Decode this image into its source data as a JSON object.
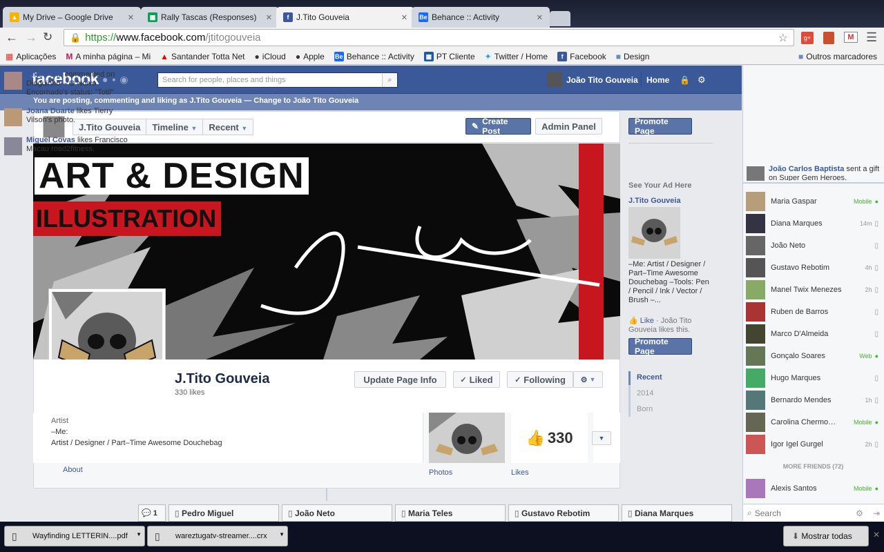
{
  "tabs": [
    {
      "title": "My Drive – Google Drive",
      "icon": "google-drive-icon",
      "color": "#f4b400"
    },
    {
      "title": "Rally Tascas (Responses)",
      "icon": "sheets-icon",
      "color": "#0f9d58"
    },
    {
      "title": "J.Tito Gouveia",
      "icon": "facebook-icon",
      "color": "#3b5998"
    },
    {
      "title": "Behance :: Activity",
      "icon": "behance-icon",
      "color": "#1769ff"
    }
  ],
  "url": {
    "scheme": "https://",
    "host": "www.facebook.com",
    "path": "/jtitogouveia"
  },
  "bookmarks": [
    "Aplicações",
    "A minha página – Mi",
    "Santander Totta Net",
    "iCloud",
    "Apple",
    "Behance :: Activity",
    "PT Cliente",
    "Twitter / Home",
    "Facebook",
    "Design"
  ],
  "bookmarks_other": "Outros marcadores",
  "fb": {
    "logo": "facebook",
    "search_placeholder": "Search for people, places and things",
    "user": "João Tito Gouveia",
    "home": "Home",
    "acting_as": "You are posting, commenting and liking as J.Tito Gouveia — Change to João Tito Gouveia",
    "page_name": "J.Tito Gouveia",
    "timeline": "Timeline",
    "recent": "Recent",
    "create_post": "Create Post",
    "admin_panel": "Admin Panel",
    "cover_title": "ART & DESIGN",
    "cover_sub": "ILLUSTRATION",
    "profile_name": "J.Tito Gouveia",
    "likes_count": "330 likes",
    "update_info": "Update Page Info",
    "liked": "Liked",
    "following": "Following",
    "about_cat": "Artist",
    "about_me": "–Me:",
    "about_desc": "Artist / Designer / Part–Time Awesome Douchebag",
    "about_link": "About",
    "photos_link": "Photos",
    "likes_link": "Likes",
    "likes_big": "330",
    "promote": "Promote Page",
    "ad_heading": "See Your Ad Here",
    "ad_title": "J.Tito Gouveia",
    "ad_text": "–Me: Artist / Designer / Part–Time Awesome Douchebag –Tools: Pen / Pencil / Ink / Vector / Brush –...",
    "ad_like": "Like",
    "ad_like_rest": " · João Tito Gouveia likes this.",
    "years": [
      "Recent",
      "2014",
      "Born"
    ]
  },
  "ticker": [
    {
      "name": "Nika Pena",
      "rest": " commented on Dioguinho – O Noivo Encornado's status: \"Totil\""
    },
    {
      "name": "Joana Duarte",
      "rest": " likes Tierry Vilson's photo."
    },
    {
      "name": "Miguel Covas",
      "rest": " likes Francisco Macau road2fitness."
    },
    {
      "name": "João Carlos Baptista",
      "rest": " sent a gift on Super Gem Heroes."
    }
  ],
  "friends": [
    {
      "name": "Maria Gaspar",
      "status": "Mobile"
    },
    {
      "name": "Diana Marques",
      "status": "14m"
    },
    {
      "name": "João Neto",
      "status": ""
    },
    {
      "name": "Gustavo Rebotim",
      "status": "4h"
    },
    {
      "name": "Manel Twix Menezes",
      "status": "2h"
    },
    {
      "name": "Ruben de Barros",
      "status": ""
    },
    {
      "name": "Marco D'Almeida",
      "status": ""
    },
    {
      "name": "Gonçalo Soares",
      "status": "Web"
    },
    {
      "name": "Hugo Marques",
      "status": ""
    },
    {
      "name": "Bernardo Mendes",
      "status": "1h"
    },
    {
      "name": "Carolina Chermo…",
      "status": "Mobile"
    },
    {
      "name": "Igor Igel Gurgel",
      "status": "2h"
    }
  ],
  "more_friends": "MORE FRIENDS (72)",
  "extra_friend": {
    "name": "Alexis Santos",
    "status": "Mobile"
  },
  "chat_search": "Search",
  "chat_tabs": [
    "Pedro Miguel",
    "João Neto",
    "Maria Teles",
    "Gustavo Rebotim",
    "Diana Marques"
  ],
  "chat_count": "1",
  "downloads": [
    "Wayfinding LETTERIN....pdf",
    "wareztugatv-streamer....crx"
  ],
  "show_all": "Mostrar todas"
}
